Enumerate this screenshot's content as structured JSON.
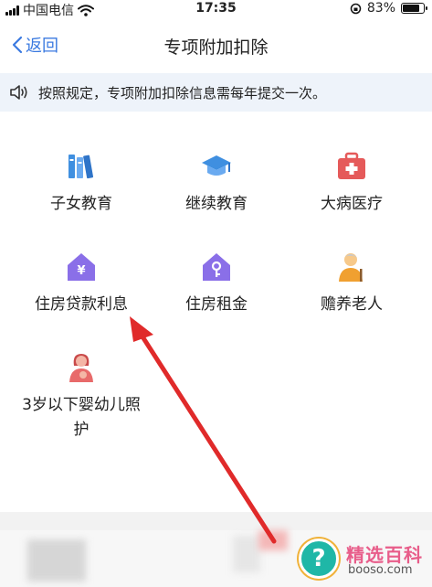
{
  "status_bar": {
    "carrier": "中国电信",
    "time": "17:35",
    "battery": "83%",
    "battery_level": 0.83
  },
  "nav": {
    "back_label": "返回",
    "title": "专项附加扣除"
  },
  "notice": {
    "icon": "speaker-icon",
    "text": "按照规定，专项附加扣除信息需每年提交一次。"
  },
  "items": [
    {
      "label": "子女教育",
      "icon": "books-icon",
      "color": "#3f8fe0"
    },
    {
      "label": "继续教育",
      "icon": "graduation-cap-icon",
      "color": "#3f8fe0"
    },
    {
      "label": "大病医疗",
      "icon": "medical-kit-icon",
      "color": "#e55a5a"
    },
    {
      "label": "住房贷款利息",
      "icon": "house-yuan-icon",
      "color": "#8a6fe8"
    },
    {
      "label": "住房租金",
      "icon": "house-key-icon",
      "color": "#8a6fe8"
    },
    {
      "label": "赡养老人",
      "icon": "elder-icon",
      "color": "#f0a030"
    },
    {
      "label": "3岁以下婴幼儿照护",
      "icon": "mother-baby-icon",
      "color": "#e86a6a"
    }
  ],
  "watermark": {
    "symbol": "?",
    "brand": "精选百科",
    "site": "booso.com"
  },
  "colors": {
    "accent": "#3b7ae0",
    "notice_bg": "#eef3fa",
    "arrow": "#e02a2a"
  }
}
